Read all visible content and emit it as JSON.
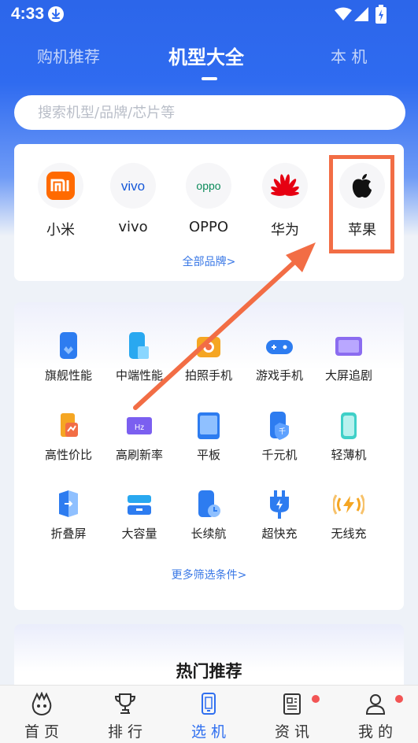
{
  "status_bar": {
    "time": "4:33"
  },
  "tabs": [
    {
      "label": "购机推荐",
      "active": false
    },
    {
      "label": "机型大全",
      "active": true
    },
    {
      "label": "本 机",
      "active": false
    }
  ],
  "search": {
    "placeholder": "搜索机型/品牌/芯片等",
    "value": ""
  },
  "brands": {
    "items": [
      {
        "name": "小米",
        "logo": "xiaomi-logo"
      },
      {
        "name": "vivo",
        "logo": "vivo-logo"
      },
      {
        "name": "OPPO",
        "logo": "oppo-logo"
      },
      {
        "name": "华为",
        "logo": "huawei-logo"
      },
      {
        "name": "苹果",
        "logo": "apple-logo"
      }
    ],
    "all_link": "全部品牌>"
  },
  "filters": {
    "items": [
      {
        "label": "旗舰性能",
        "icon": "flagship-phone-icon"
      },
      {
        "label": "中端性能",
        "icon": "midrange-phone-icon"
      },
      {
        "label": "拍照手机",
        "icon": "camera-phone-icon"
      },
      {
        "label": "游戏手机",
        "icon": "gamepad-icon"
      },
      {
        "label": "大屏追剧",
        "icon": "big-screen-icon"
      },
      {
        "label": "高性价比",
        "icon": "value-icon"
      },
      {
        "label": "高刷新率",
        "icon": "refresh-rate-icon"
      },
      {
        "label": "平板",
        "icon": "tablet-icon"
      },
      {
        "label": "千元机",
        "icon": "budget-phone-icon"
      },
      {
        "label": "轻薄机",
        "icon": "thin-phone-icon"
      },
      {
        "label": "折叠屏",
        "icon": "foldable-icon"
      },
      {
        "label": "大容量",
        "icon": "storage-icon"
      },
      {
        "label": "长续航",
        "icon": "battery-life-icon"
      },
      {
        "label": "超快充",
        "icon": "fast-charge-icon"
      },
      {
        "label": "无线充",
        "icon": "wireless-charge-icon"
      }
    ],
    "more_link": "更多筛选条件>"
  },
  "hot": {
    "title": "热门推荐"
  },
  "bottom_nav": [
    {
      "label": "首页",
      "icon": "home-icon",
      "active": false,
      "badge": false
    },
    {
      "label": "排行",
      "icon": "trophy-icon",
      "active": false,
      "badge": false
    },
    {
      "label": "选机",
      "icon": "phone-select-icon",
      "active": true,
      "badge": false
    },
    {
      "label": "资讯",
      "icon": "news-icon",
      "active": false,
      "badge": true
    },
    {
      "label": "我的",
      "icon": "profile-icon",
      "active": false,
      "badge": true
    }
  ],
  "colors": {
    "header_blue": "#2f6bf0",
    "link_blue": "#3a78e6",
    "annotation_orange": "#f26d45",
    "badge_red": "#f25555"
  }
}
